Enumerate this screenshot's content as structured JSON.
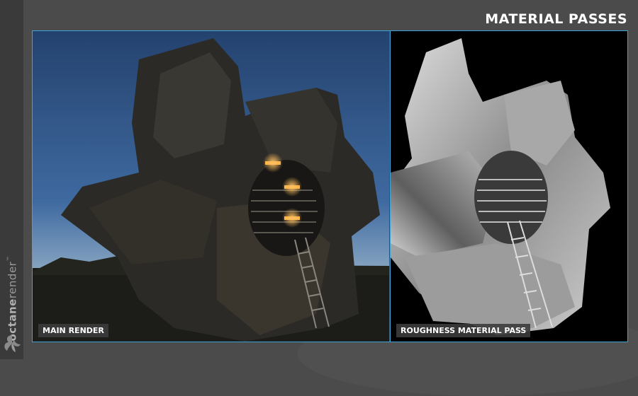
{
  "header": {
    "title": "MATERIAL PASSES"
  },
  "brand": {
    "name_part1": "octane",
    "name_part2": "render",
    "trademark": "™"
  },
  "panels": {
    "main": {
      "label": "MAIN RENDER"
    },
    "roughness": {
      "label": "ROUGHNESS MATERIAL PASS"
    }
  },
  "colors": {
    "accent_border": "#3ea3d8",
    "background": "#4b4b4b",
    "sidebar": "#3a3a3a"
  }
}
